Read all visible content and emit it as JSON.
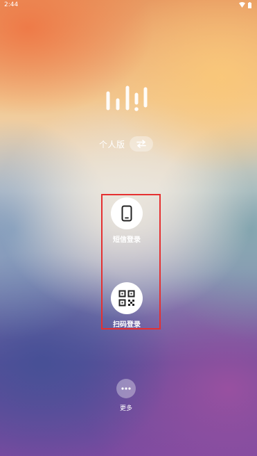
{
  "status_bar": {
    "time": "2:44"
  },
  "mode": {
    "label": "个人版",
    "switch_icon": "swap-arrows-icon"
  },
  "login_options": [
    {
      "label": "短信登录",
      "icon": "phone-icon"
    },
    {
      "label": "扫码登录",
      "icon": "qr-code-icon"
    }
  ],
  "more": {
    "label": "更多",
    "icon": "ellipsis-icon"
  },
  "colors": {
    "highlight": "#e53030",
    "button_bg": "#ffffff",
    "icon": "#222222"
  }
}
